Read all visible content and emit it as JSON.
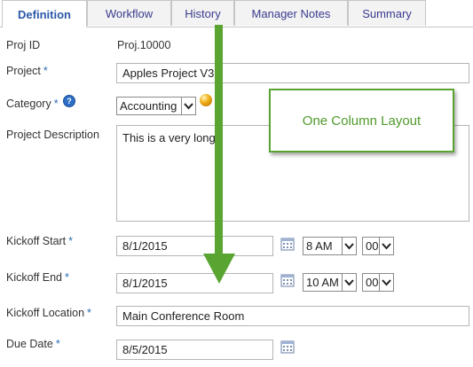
{
  "tabs": [
    {
      "label": "Definition",
      "active": true
    },
    {
      "label": "Workflow",
      "active": false
    },
    {
      "label": "History",
      "active": false
    },
    {
      "label": "Manager Notes",
      "active": false
    },
    {
      "label": "Summary",
      "active": false
    }
  ],
  "form": {
    "proj_id": {
      "label": "Proj ID",
      "value": "Proj.10000"
    },
    "project": {
      "label": "Project",
      "required_mark": "*",
      "value": "Apples Project V3"
    },
    "category": {
      "label": "Category",
      "required_mark": "*",
      "help_glyph": "?",
      "value": "Accounting"
    },
    "description": {
      "label": "Project Description",
      "value": "This is a very long"
    },
    "kickoff_start": {
      "label": "Kickoff Start",
      "required_mark": "*",
      "date": "8/1/2015",
      "hour": "8 AM",
      "minute": "00"
    },
    "kickoff_end": {
      "label": "Kickoff End",
      "required_mark": "*",
      "date": "8/1/2015",
      "hour": "10 AM",
      "minute": "00"
    },
    "kickoff_location": {
      "label": "Kickoff Location",
      "required_mark": "*",
      "value": "Main Conference Room"
    },
    "due_date": {
      "label": "Due Date",
      "required_mark": "*",
      "date": "8/5/2015"
    }
  },
  "callout": {
    "text": "One Column Layout"
  },
  "colors": {
    "accent_green": "#5aa532",
    "tab_text": "#2a58a8",
    "required": "#2e6db4"
  },
  "icons": [
    "help-icon",
    "status-orb-icon",
    "calendar-icon",
    "dropdown-arrow-icon",
    "arrow-down-icon"
  ]
}
